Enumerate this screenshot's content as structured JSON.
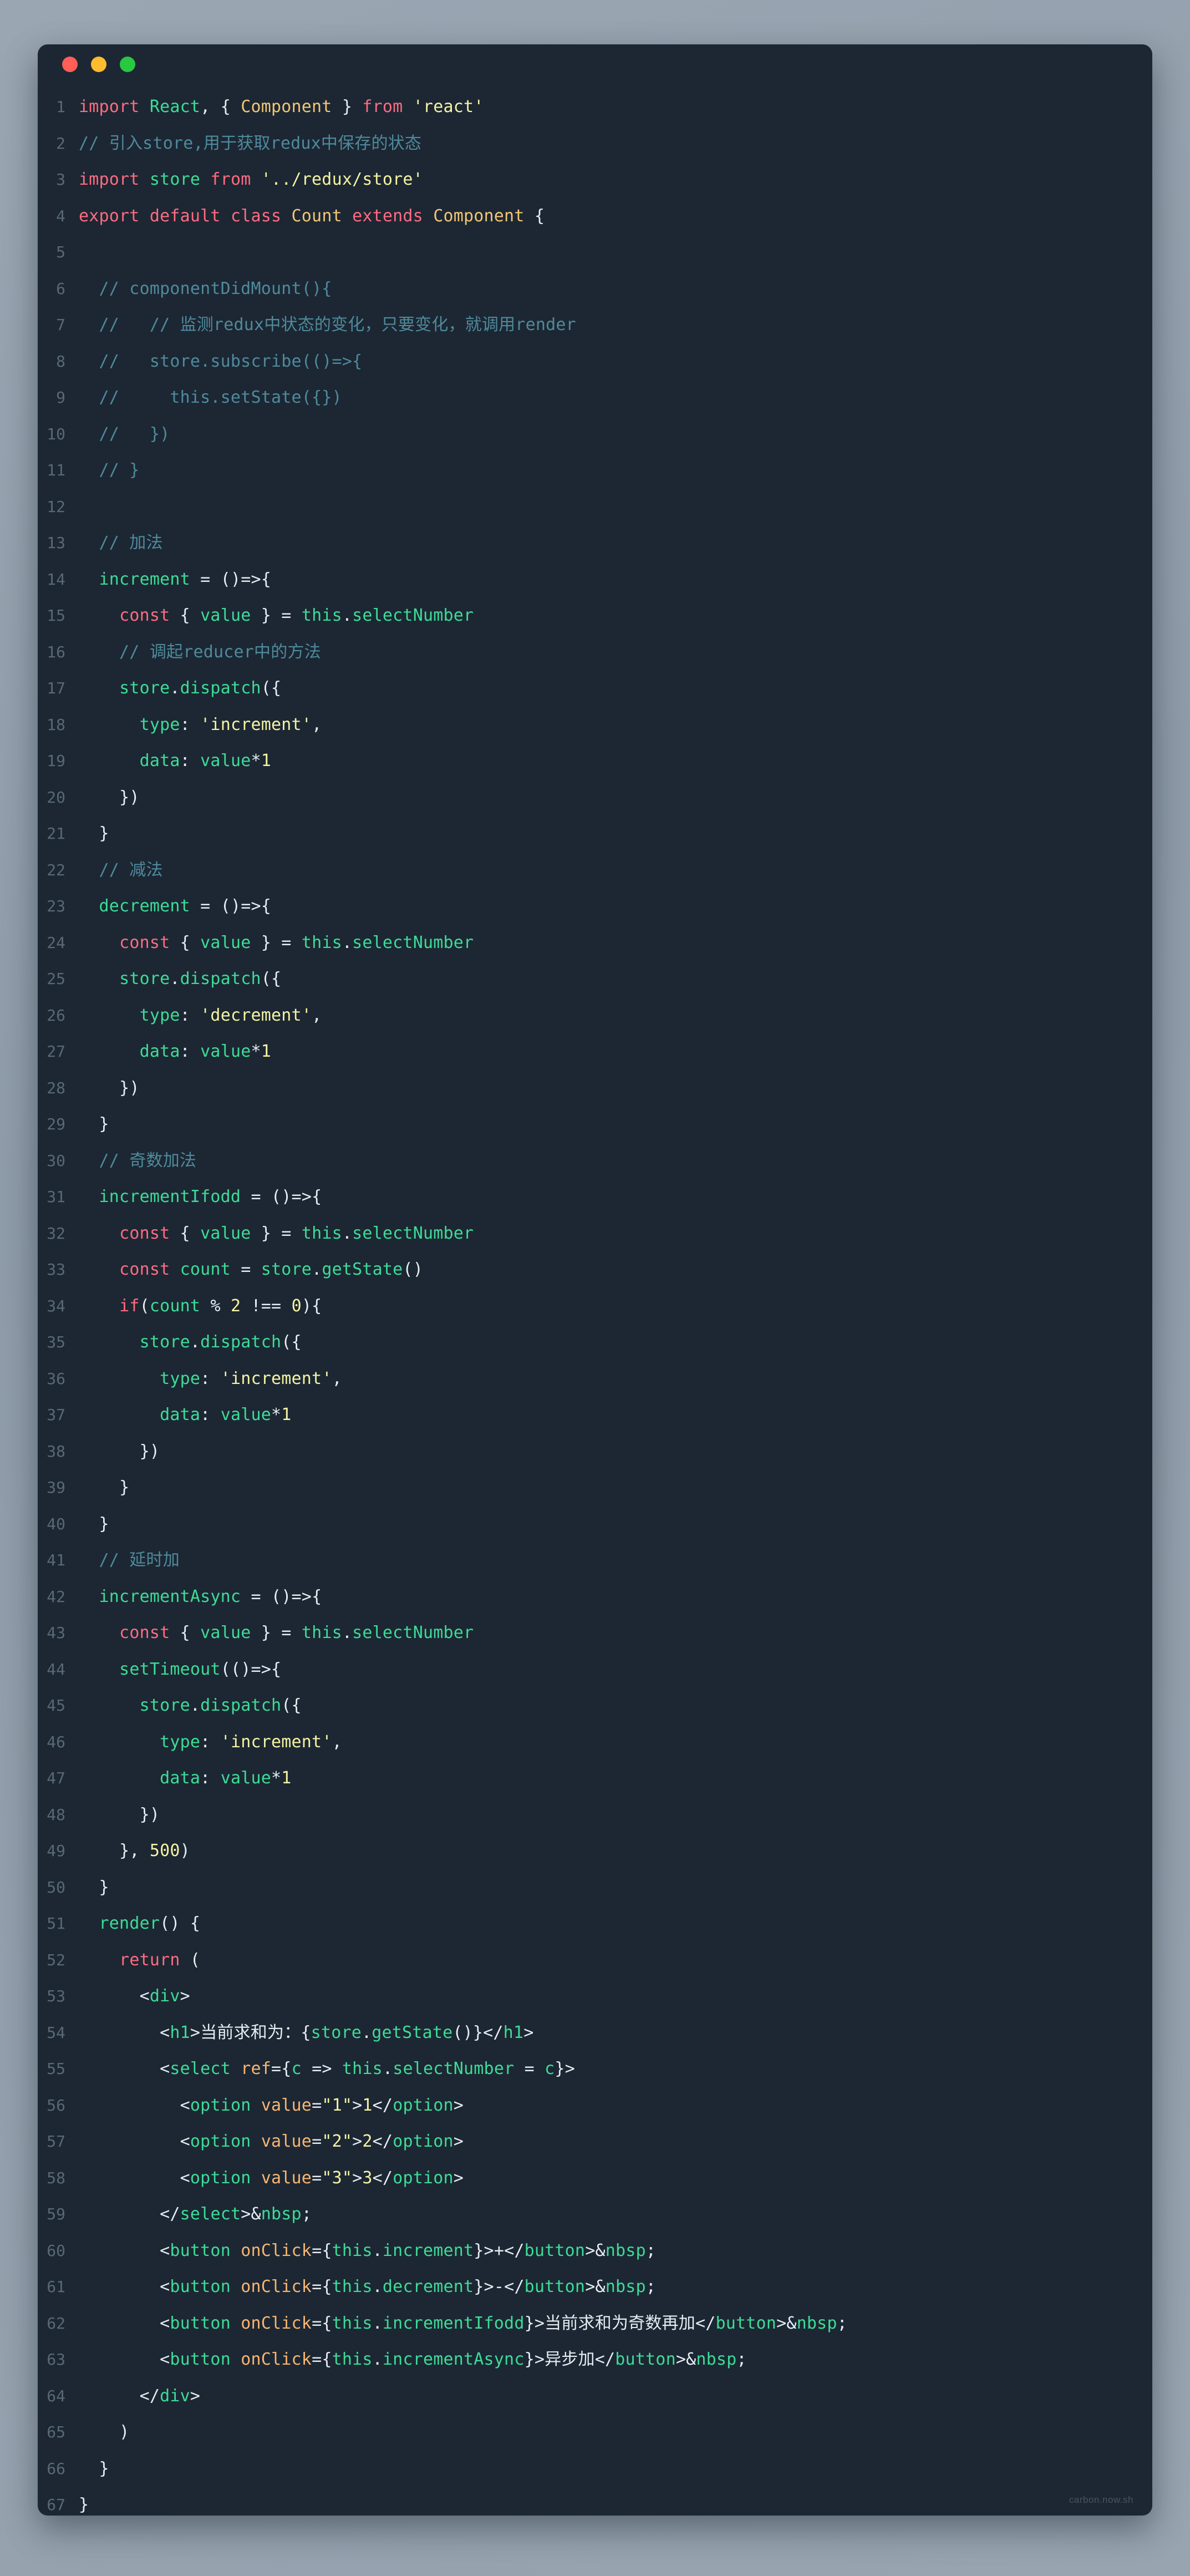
{
  "window": {
    "title": "",
    "background_color": "#1c2733",
    "page_background_color": "#8e9ba9",
    "traffic_lights": [
      {
        "name": "close",
        "color": "#ff5f57"
      },
      {
        "name": "minimize",
        "color": "#febc2e"
      },
      {
        "name": "maximize",
        "color": "#28c840"
      }
    ]
  },
  "theme": {
    "keyword": "#ff6b81",
    "function": "#3ddc97",
    "string": "#f5f3a3",
    "comment": "#4f8a9c",
    "plain": "#e6edf3",
    "attribute": "#f9b572",
    "classname": "#f2c675",
    "line_number": "#5a6876"
  },
  "watermark": "carbon.now.sh",
  "code": {
    "language": "jsx",
    "line_count": 68,
    "lines": [
      {
        "n": "1",
        "text": "import React, { Component } from 'react'"
      },
      {
        "n": "2",
        "text": "// 引入store,用于获取redux中保存的状态"
      },
      {
        "n": "3",
        "text": "import store from '../redux/store'"
      },
      {
        "n": "4",
        "text": "export default class Count extends Component {"
      },
      {
        "n": "5",
        "text": ""
      },
      {
        "n": "6",
        "text": "  // componentDidMount(){"
      },
      {
        "n": "7",
        "text": "  //   // 监测redux中状态的变化，只要变化，就调用render"
      },
      {
        "n": "8",
        "text": "  //   store.subscribe(()=>{"
      },
      {
        "n": "9",
        "text": "  //     this.setState({})"
      },
      {
        "n": "10",
        "text": "  //   })"
      },
      {
        "n": "11",
        "text": "  // }"
      },
      {
        "n": "12",
        "text": ""
      },
      {
        "n": "13",
        "text": "  // 加法"
      },
      {
        "n": "14",
        "text": "  increment = ()=>{"
      },
      {
        "n": "15",
        "text": "    const { value } = this.selectNumber"
      },
      {
        "n": "16",
        "text": "    // 调起reducer中的方法"
      },
      {
        "n": "17",
        "text": "    store.dispatch({"
      },
      {
        "n": "18",
        "text": "      type: 'increment',"
      },
      {
        "n": "19",
        "text": "      data: value*1"
      },
      {
        "n": "20",
        "text": "    })"
      },
      {
        "n": "21",
        "text": "  }"
      },
      {
        "n": "22",
        "text": "  // 减法"
      },
      {
        "n": "23",
        "text": "  decrement = ()=>{"
      },
      {
        "n": "24",
        "text": "    const { value } = this.selectNumber"
      },
      {
        "n": "25",
        "text": "    store.dispatch({"
      },
      {
        "n": "26",
        "text": "      type: 'decrement',"
      },
      {
        "n": "27",
        "text": "      data: value*1"
      },
      {
        "n": "28",
        "text": "    })"
      },
      {
        "n": "29",
        "text": "  }"
      },
      {
        "n": "30",
        "text": "  // 奇数加法"
      },
      {
        "n": "31",
        "text": "  incrementIfodd = ()=>{"
      },
      {
        "n": "32",
        "text": "    const { value } = this.selectNumber"
      },
      {
        "n": "33",
        "text": "    const count = store.getState()"
      },
      {
        "n": "34",
        "text": "    if(count % 2 !== 0){"
      },
      {
        "n": "35",
        "text": "      store.dispatch({"
      },
      {
        "n": "36",
        "text": "        type: 'increment',"
      },
      {
        "n": "37",
        "text": "        data: value*1"
      },
      {
        "n": "38",
        "text": "      })"
      },
      {
        "n": "39",
        "text": "    }"
      },
      {
        "n": "40",
        "text": "  }"
      },
      {
        "n": "41",
        "text": "  // 延时加"
      },
      {
        "n": "42",
        "text": "  incrementAsync = ()=>{"
      },
      {
        "n": "43",
        "text": "    const { value } = this.selectNumber"
      },
      {
        "n": "44",
        "text": "    setTimeout(()=>{"
      },
      {
        "n": "45",
        "text": "      store.dispatch({"
      },
      {
        "n": "46",
        "text": "        type: 'increment',"
      },
      {
        "n": "47",
        "text": "        data: value*1"
      },
      {
        "n": "48",
        "text": "      })"
      },
      {
        "n": "49",
        "text": "    }, 500)"
      },
      {
        "n": "50",
        "text": "  }"
      },
      {
        "n": "51",
        "text": "  render() {"
      },
      {
        "n": "52",
        "text": "    return ("
      },
      {
        "n": "53",
        "text": "      <div>"
      },
      {
        "n": "54",
        "text": "        <h1>当前求和为：{store.getState()}</h1>"
      },
      {
        "n": "55",
        "text": "        <select ref={c => this.selectNumber = c}>"
      },
      {
        "n": "56",
        "text": "          <option value=\"1\">1</option>"
      },
      {
        "n": "57",
        "text": "          <option value=\"2\">2</option>"
      },
      {
        "n": "58",
        "text": "          <option value=\"3\">3</option>"
      },
      {
        "n": "59",
        "text": "        </select>&nbsp;"
      },
      {
        "n": "60",
        "text": "        <button onClick={this.increment}>+</button>&nbsp;"
      },
      {
        "n": "61",
        "text": "        <button onClick={this.decrement}>-</button>&nbsp;"
      },
      {
        "n": "62",
        "text": "        <button onClick={this.incrementIfodd}>当前求和为奇数再加</button>&nbsp;"
      },
      {
        "n": "63",
        "text": "        <button onClick={this.incrementAsync}>异步加</button>&nbsp;"
      },
      {
        "n": "64",
        "text": "      </div>"
      },
      {
        "n": "65",
        "text": "    )"
      },
      {
        "n": "66",
        "text": "  }"
      },
      {
        "n": "67",
        "text": "}"
      },
      {
        "n": "68",
        "text": ""
      }
    ]
  }
}
